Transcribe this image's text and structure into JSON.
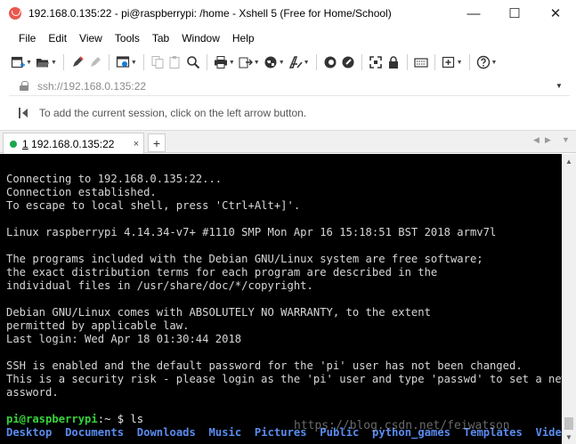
{
  "window": {
    "title": "192.168.0.135:22 - pi@raspberrypi: /home - Xshell 5 (Free for Home/School)",
    "minimize_glyph": "—",
    "maximize_glyph": "☐",
    "close_glyph": "✕"
  },
  "menu": [
    "File",
    "Edit",
    "View",
    "Tools",
    "Tab",
    "Window",
    "Help"
  ],
  "address": {
    "value": "ssh://192.168.0.135:22"
  },
  "hint": {
    "text": "To add the current session, click on the left arrow button."
  },
  "tab": {
    "number": "1",
    "label": " 192.168.0.135:22",
    "status_color": "#1aa64b",
    "close_glyph": "×",
    "add_glyph": "+"
  },
  "terminal": {
    "lines": [
      "Connecting to 192.168.0.135:22...",
      "Connection established.",
      "To escape to local shell, press 'Ctrl+Alt+]'.",
      "",
      "Linux raspberrypi 4.14.34-v7+ #1110 SMP Mon Apr 16 15:18:51 BST 2018 armv7l",
      "",
      "The programs included with the Debian GNU/Linux system are free software;",
      "the exact distribution terms for each program are described in the",
      "individual files in /usr/share/doc/*/copyright.",
      "",
      "Debian GNU/Linux comes with ABSOLUTELY NO WARRANTY, to the extent",
      "permitted by applicable law.",
      "Last login: Wed Apr 18 01:30:44 2018",
      "",
      "SSH is enabled and the default password for the 'pi' user has not been changed.",
      "This is a security risk - please login as the 'pi' user and type 'passwd' to set a new p",
      "assword.",
      ""
    ],
    "prompt_user": "pi@raspberrypi",
    "prompt_rest": ":~ $ ",
    "command": "ls",
    "ls_items": [
      "Desktop",
      "Documents",
      "Downloads",
      "Music",
      "Pictures",
      "Public",
      "python_games",
      "Templates",
      "Videos"
    ],
    "watermark": "https://blog.csdn.net/feiwatson",
    "colors": {
      "background": "#000000",
      "text": "#d7d7d7",
      "prompt": "#35d43b",
      "directory": "#5a8cf0"
    }
  }
}
